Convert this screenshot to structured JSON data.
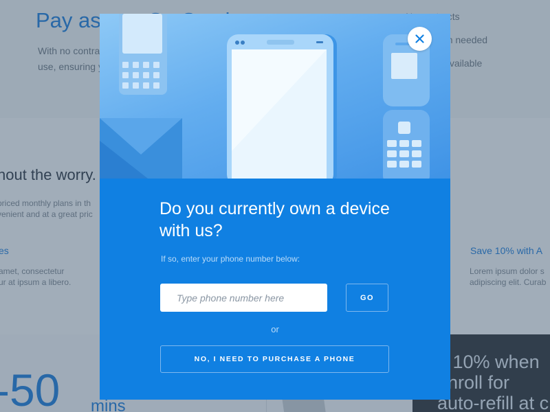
{
  "background": {
    "heading": "Pay as you Go Service",
    "intro_line1": "With no contract required, pay only for what you",
    "intro_line2": "use, ensuring you are never over charged.",
    "right_item1": "No contracts",
    "right_item2": "Refill when needed",
    "right_item3": "Instantly available",
    "section_heading": "hout the worry.",
    "section_line1": "priced monthly plans in th",
    "section_line2": "venient and at a great pric",
    "feature_left_title": "es",
    "feature_left_line1": "amet, consectetur",
    "feature_left_line2": "ur at ipsum a libero.",
    "feature_right_title": "Save 10% with A",
    "feature_right_line1": "Lorem ipsum dolor s",
    "feature_right_line2": "adipiscing elit. Curab",
    "minutes_value": "-50",
    "minutes_unit": "mins",
    "promo_line1": "e 10% when",
    "promo_line2": "enroll for",
    "promo_line3": "auto-refill at ch"
  },
  "modal": {
    "title": "Do you currently own a device with us?",
    "subtitle": "If so, enter your phone number below:",
    "phone_placeholder": "Type phone number here",
    "go_label": "GO",
    "or_label": "or",
    "purchase_label": "NO, I NEED TO PURCHASE A PHONE",
    "close_icon": "close-icon"
  },
  "colors": {
    "brand_blue": "#1080e2",
    "accent_blue": "#1a7ad9",
    "overlay": "rgba(58,82,106,0.45)"
  }
}
